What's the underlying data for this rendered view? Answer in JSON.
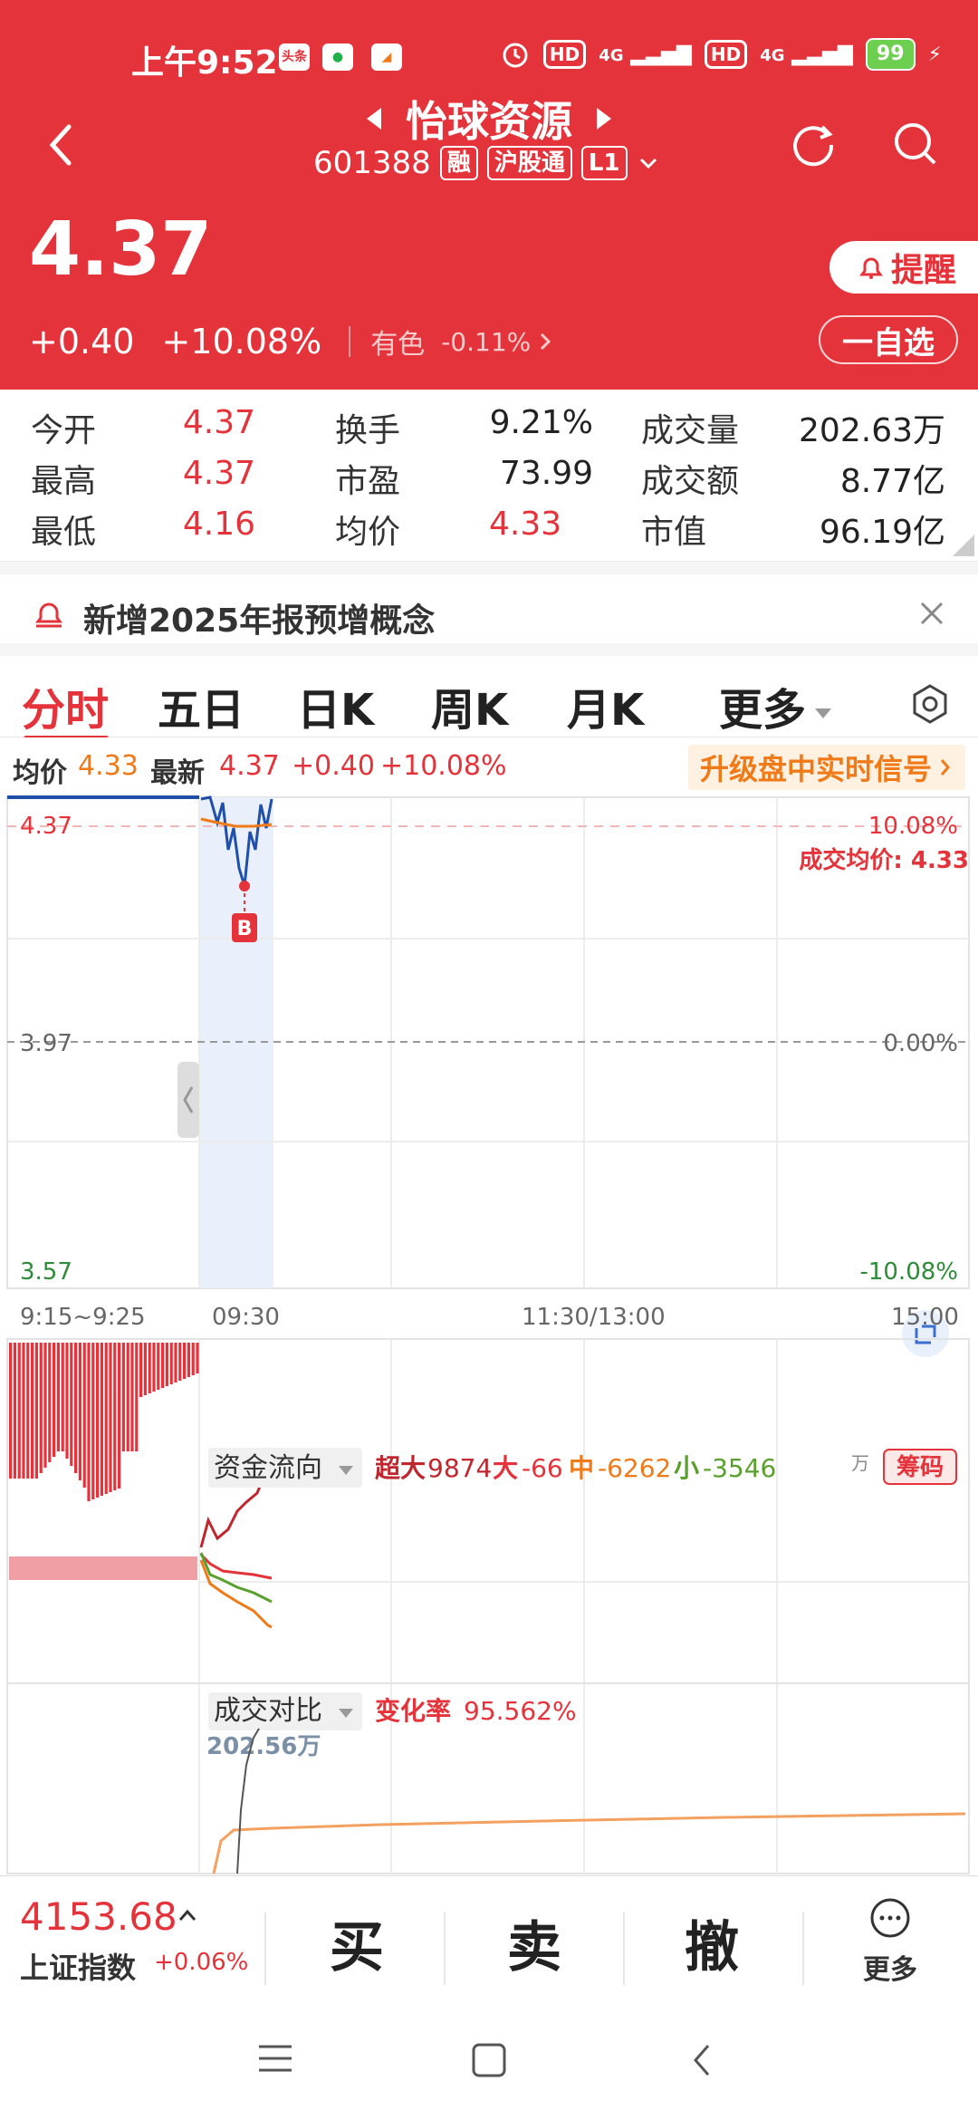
{
  "status_bar": {
    "time": "上午9:52",
    "app_icons": [
      "头条",
      "微信",
      "通知"
    ],
    "net1": "4G",
    "net2": "4G",
    "hd1": "HD",
    "hd2": "HD",
    "battery": "99"
  },
  "header": {
    "title": "怡球资源",
    "code": "601388",
    "tags": [
      "融",
      "沪股通",
      "L1"
    ],
    "price": "4.37",
    "change": "+0.40",
    "change_pct": "+10.08%",
    "sector_name": "有色",
    "sector_change": "-0.11%",
    "remind_label": "提醒",
    "watch_label": "一自选"
  },
  "quote": {
    "rows": [
      [
        {
          "label": "今开",
          "value": "4.37"
        },
        {
          "label": "换手",
          "value": "9.21%"
        },
        {
          "label": "成交量",
          "value": "202.63万"
        }
      ],
      [
        {
          "label": "最高",
          "value": "4.37"
        },
        {
          "label": "市盈",
          "value": "73.99"
        },
        {
          "label": "成交额",
          "value": "8.77亿"
        }
      ],
      [
        {
          "label": "最低",
          "value": "4.16"
        },
        {
          "label": "均价",
          "value": "4.33"
        },
        {
          "label": "市值",
          "value": "96.19亿"
        }
      ]
    ]
  },
  "notice": {
    "text": "新增2025年报预增概念"
  },
  "tabs": {
    "items": [
      "分时",
      "五日",
      "日K",
      "周K",
      "月K",
      "更多"
    ],
    "active": "分时"
  },
  "info_row": {
    "avg_label": "均价",
    "avg_value": "4.33",
    "latest_label": "最新",
    "latest_value": "4.37",
    "change": "+0.40",
    "change_pct": "+10.08%",
    "upgrade": "升级盘中实时信号"
  },
  "chart": {
    "y_top": "4.37",
    "y_mid": "3.97",
    "y_bottom": "3.57",
    "pct_top": "10.08%",
    "pct_mid": "0.00%",
    "pct_bottom": "-10.08%",
    "avg_trade_label": "成交均价: 4.33",
    "marker": "B",
    "time_labels": [
      "9:15~9:25",
      "09:30",
      "11:30/13:00",
      "15:00"
    ],
    "money_flow": {
      "title": "资金流向",
      "super_label": "超大",
      "super_value": "9874",
      "big_label": "大",
      "big_value": "-66",
      "mid_label": "中",
      "mid_value": "-6262",
      "small_label": "小",
      "small_value": "-3546",
      "unit": "万",
      "chip_btn": "筹码"
    },
    "volume_compare": {
      "title": "成交对比",
      "rate_label": "变化率",
      "rate_value": "95.562%",
      "volume_label": "202.56万"
    },
    "colors": {
      "red": "#e4333a",
      "orange": "#f07a17",
      "green": "#5aa02c",
      "blue": "#1f4fa8",
      "dark_red": "#c0262d"
    }
  },
  "trade_bar": {
    "index_value": "4153.68",
    "index_name": "上证指数",
    "index_change": "+0.06%",
    "buy": "买",
    "sell": "卖",
    "cancel": "撤",
    "more": "更多"
  }
}
